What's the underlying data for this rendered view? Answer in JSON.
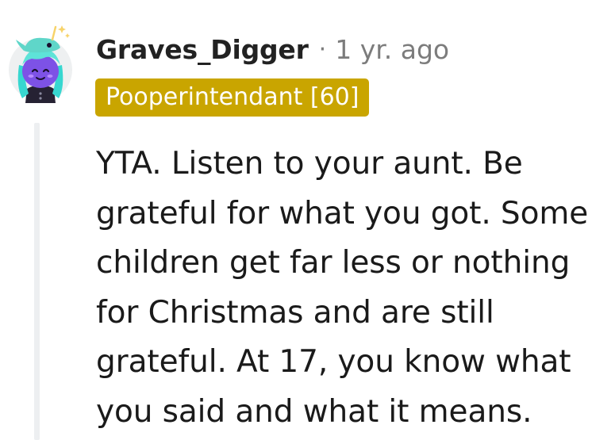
{
  "comment": {
    "avatar_icon": "snoo-avatar-icon",
    "username": "Graves_Digger",
    "separator": "·",
    "timestamp": "1 yr. ago",
    "flair": "Pooperintendant [60]",
    "body": "YTA. Listen to your aunt. Be grateful for what you got. Some children get far less or nothing for Christmas and are still grateful. At 17, you know what you said and what it means."
  },
  "colors": {
    "flair_background": "#c9a500",
    "thread_line": "#edeff1",
    "meta_text": "#7c7c7c"
  }
}
